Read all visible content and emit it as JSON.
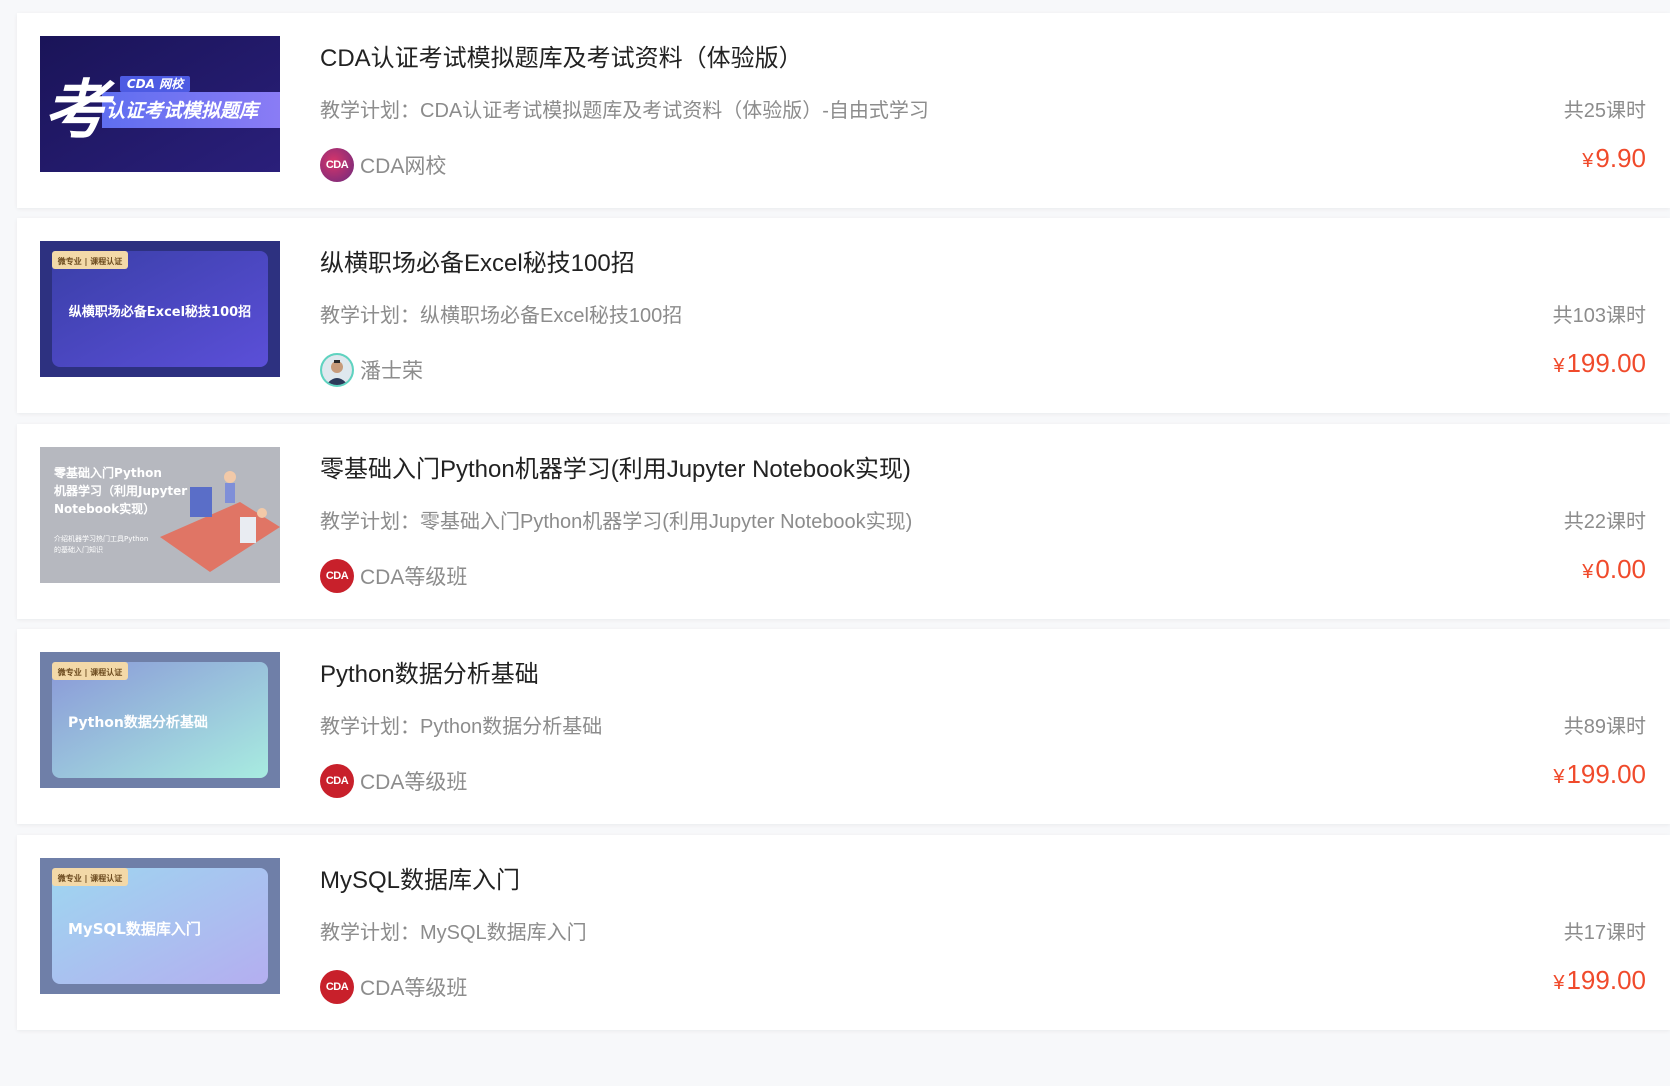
{
  "colors": {
    "price": "#f04a2b",
    "title": "#222222",
    "muted": "#8c8c8c",
    "card_bg": "#ffffff",
    "page_bg": "#f7f8fa"
  },
  "courses": [
    {
      "title": "CDA认证考试模拟题库及考试资料（体验版）",
      "plan": "教学计划：CDA认证考试模拟题库及考试资料（体验版）-自由式学习",
      "lessons": "共25课时",
      "teacher": "CDA网校",
      "avatar_text": "CDA",
      "currency": "¥",
      "price": "9.90",
      "thumb": {
        "badge": "CDA 网校",
        "big": "考",
        "text": "认证考试模拟题库"
      }
    },
    {
      "title": "纵横职场必备Excel秘技100招",
      "plan": "教学计划：纵横职场必备Excel秘技100招",
      "lessons": "共103课时",
      "teacher": "潘士荣",
      "avatar_text": "",
      "currency": "¥",
      "price": "199.00",
      "thumb": {
        "badge": "微专业 | 课程认证",
        "text": "纵横职场必备Excel秘技100招"
      }
    },
    {
      "title": "零基础入门Python机器学习(利用Jupyter Notebook实现)",
      "plan": "教学计划：零基础入门Python机器学习(利用Jupyter Notebook实现)",
      "lessons": "共22课时",
      "teacher": "CDA等级班",
      "avatar_text": "CDA",
      "currency": "¥",
      "price": "0.00",
      "thumb": {
        "line1": "零基础入门Python",
        "line2": "机器学习（利用Jupyter",
        "line3": "Notebook实现）",
        "sub1": "介绍机器学习热门工具Python",
        "sub2": "的基础入门知识"
      }
    },
    {
      "title": "Python数据分析基础",
      "plan": "教学计划：Python数据分析基础",
      "lessons": "共89课时",
      "teacher": "CDA等级班",
      "avatar_text": "CDA",
      "currency": "¥",
      "price": "199.00",
      "thumb": {
        "badge": "微专业 | 课程认证",
        "text": "Python数据分析基础"
      }
    },
    {
      "title": "MySQL数据库入门",
      "plan": "教学计划：MySQL数据库入门",
      "lessons": "共17课时",
      "teacher": "CDA等级班",
      "avatar_text": "CDA",
      "currency": "¥",
      "price": "199.00",
      "thumb": {
        "badge": "微专业 | 课程认证",
        "text": "MySQL数据库入门"
      }
    }
  ]
}
